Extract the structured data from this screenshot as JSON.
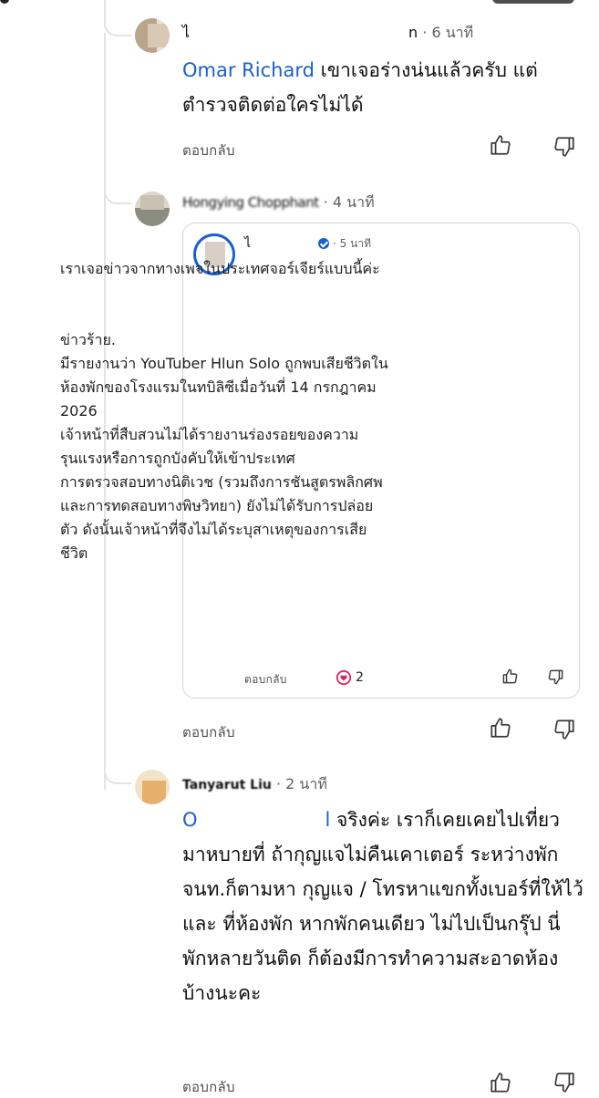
{
  "comments": [
    {
      "author": "ไ",
      "author_tail": "n",
      "time": "· 6 นาที",
      "mention": "Omar Richard",
      "text": " เขาเจอร่างน่นแล้วครับ แต่ตำรวจติดต่อใครไม่ได้",
      "reply": "ตอบกลับ"
    },
    {
      "author": "Hongying Chopphant",
      "time": "· 4 นาที",
      "quoted": {
        "author": "ไ",
        "time": "· 5 นาที",
        "paragraphs": [
          "เราเจอข่าวจากทางเพจในประเทศจอร์เจียร์แบบนี้ค่ะ",
          "",
          "ข่าวร้าย.",
          "มีรายงานว่า YouTuber Hlun Solo ถูกพบเสียชีวิตในห้องพักของโรงแรมในทบิลิซีเมื่อวันที่ 14 กรกฎาคม 2026",
          "เจ้าหน้าที่สืบสวนไม่ได้รายงานร่องรอยของความรุนแรงหรือการถูกบังคับให้เข้าประเทศ",
          "การตรวจสอบทางนิติเวช (รวมถึงการชันสูตรพลิกศพและการทดสอบทางพิษวิทยา) ยังไม่ได้รับการปล่อยตัว ดังนั้นเจ้าหน้าที่จึงไม่ได้ระบุสาเหตุของการเสียชีวิต"
        ],
        "reply": "ตอบกลับ",
        "reaction_count": "2"
      },
      "reply": "ตอบกลับ"
    },
    {
      "author": "Tanyarut Liu",
      "time": "· 2 นาที",
      "mention": "O",
      "mention_tail": "l",
      "text": " จริงค่ะ  เราก็เคยเคยไปเที่ยวมาหบายที่  ถ้ากุญแจไม่คืนเคาเตอร์ ระหว่างพัก  จนท.ก็ตามหา กุญแจ  / โทรหาแขกทั้งเบอร์ที่ให้ไว้ และ ที่ห้องพัก  หากพักคนเดียว ไม่ไปเป็นกรุ๊ป  นี่พักหลายวันติด ก็ต้องมีการทำความสะอาดห้องบ้างนะคะ",
      "reply": "ตอบกลับ"
    }
  ],
  "icons": [
    "thumb-up-icon",
    "thumb-down-icon",
    "heart-reaction-icon",
    "verified-badge-icon"
  ],
  "colors": {
    "mention": "#1a5fd0",
    "reaction": "#e0245e",
    "line": "#e3e3e3"
  }
}
